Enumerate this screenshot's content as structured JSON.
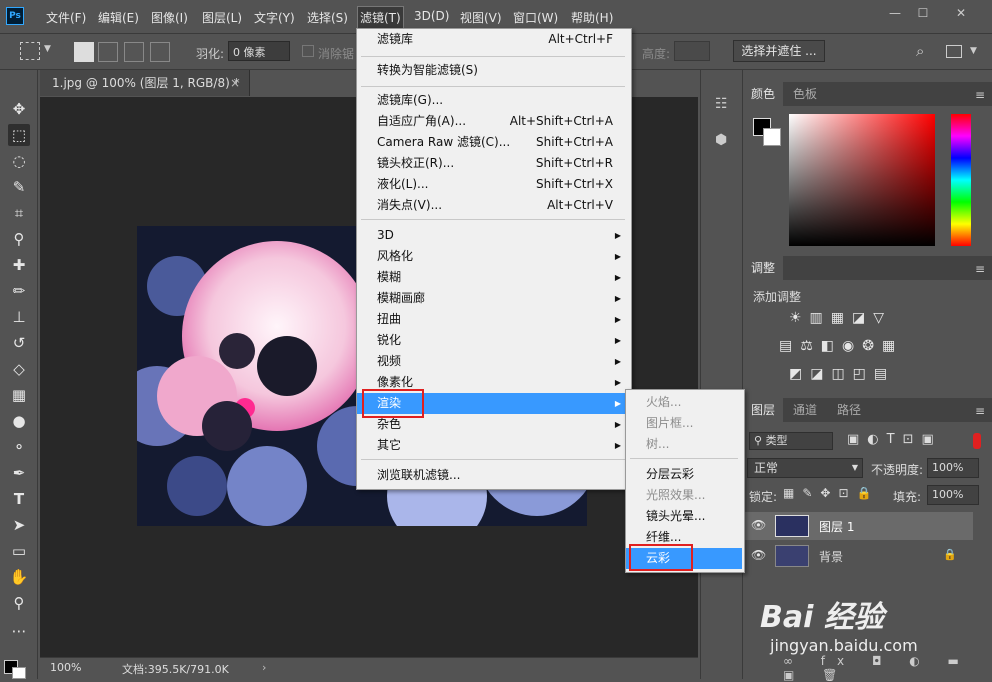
{
  "app": {
    "logo": "Ps"
  },
  "menubar": {
    "items": [
      "文件(F)",
      "编辑(E)",
      "图像(I)",
      "图层(L)",
      "文字(Y)",
      "选择(S)",
      "滤镜(T)",
      "3D(D)",
      "视图(V)",
      "窗口(W)",
      "帮助(H)"
    ],
    "active": "滤镜(T)"
  },
  "window_controls": {
    "minimize": "—",
    "maximize": "☐",
    "close": "✕"
  },
  "options_bar": {
    "feather_label": "羽化:",
    "feather_value": "0 像素",
    "antialias_label": "消除锯齿",
    "height_label": "高度:",
    "select_mask_button": "选择并遮住 ..."
  },
  "document": {
    "tab_title": "1.jpg @ 100% (图层 1, RGB/8) *",
    "zoom": "100%",
    "doc_info": "文档:395.5K/791.0K"
  },
  "filter_menu": {
    "items": [
      {
        "label": "滤镜库",
        "shortcut": "Alt+Ctrl+F"
      },
      {
        "label": "转换为智能滤镜(S)"
      },
      {
        "label": "滤镜库(G)..."
      },
      {
        "label": "自适应广角(A)...",
        "shortcut": "Alt+Shift+Ctrl+A"
      },
      {
        "label": "Camera Raw 滤镜(C)...",
        "shortcut": "Shift+Ctrl+A"
      },
      {
        "label": "镜头校正(R)...",
        "shortcut": "Shift+Ctrl+R"
      },
      {
        "label": "液化(L)...",
        "shortcut": "Shift+Ctrl+X"
      },
      {
        "label": "消失点(V)...",
        "shortcut": "Alt+Ctrl+V"
      },
      {
        "label": "3D"
      },
      {
        "label": "风格化"
      },
      {
        "label": "模糊"
      },
      {
        "label": "模糊画廊"
      },
      {
        "label": "扭曲"
      },
      {
        "label": "锐化"
      },
      {
        "label": "视频"
      },
      {
        "label": "像素化"
      },
      {
        "label": "渲染"
      },
      {
        "label": "杂色"
      },
      {
        "label": "其它"
      },
      {
        "label": "浏览联机滤镜..."
      }
    ],
    "highlighted": "渲染"
  },
  "render_submenu": {
    "items": [
      {
        "label": "火焰...",
        "disabled": true
      },
      {
        "label": "图片框...",
        "disabled": true
      },
      {
        "label": "树...",
        "disabled": true
      },
      {
        "label": "分层云彩",
        "disabled": false
      },
      {
        "label": "光照效果...",
        "disabled": true
      },
      {
        "label": "镜头光晕...",
        "disabled": false
      },
      {
        "label": "纤维...",
        "disabled": false
      },
      {
        "label": "云彩",
        "disabled": false
      }
    ],
    "highlighted": "云彩"
  },
  "color_panel": {
    "tabs": [
      "颜色",
      "色板"
    ]
  },
  "adjust_panel": {
    "tab": "调整",
    "add_label": "添加调整"
  },
  "layers_panel": {
    "tabs": [
      "图层",
      "通道",
      "路径"
    ],
    "filter_kind": "类型",
    "blend_mode": "正常",
    "opacity_label": "不透明度:",
    "opacity_value": "100%",
    "lock_label": "锁定:",
    "fill_label": "填充:",
    "fill_value": "100%",
    "layers": [
      {
        "name": "图层 1",
        "selected": true
      },
      {
        "name": "背景",
        "selected": false
      }
    ]
  },
  "watermark": {
    "logo_text": "Bai 经验",
    "url": "jingyan.baidu.com"
  },
  "colors": {
    "highlight": "#3899ff",
    "callout": "#e02020",
    "panel": "#535353"
  }
}
